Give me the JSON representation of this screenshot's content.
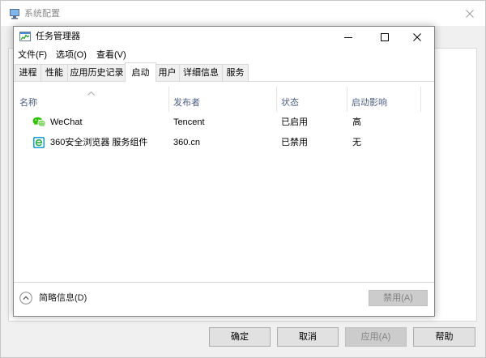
{
  "background_window": {
    "title": "系统配置",
    "title_icon": "system-configuration-icon",
    "close_icon": "close-icon",
    "buttons": [
      {
        "label": "确定",
        "disabled": false
      },
      {
        "label": "取消",
        "disabled": false
      },
      {
        "label": "应用(A)",
        "disabled": true
      },
      {
        "label": "帮助",
        "disabled": false
      }
    ]
  },
  "task_manager": {
    "title": "任务管理器",
    "title_icon": "task-manager-icon",
    "window_controls": [
      "minimize-icon",
      "maximize-icon",
      "close-icon"
    ],
    "menu": [
      {
        "label": "文件(F)"
      },
      {
        "label": "选项(O)"
      },
      {
        "label": "查看(V)"
      }
    ],
    "tabs": [
      {
        "label": "进程",
        "selected": false
      },
      {
        "label": "性能",
        "selected": false
      },
      {
        "label": "应用历史记录",
        "selected": false
      },
      {
        "label": "启动",
        "selected": true
      },
      {
        "label": "用户",
        "selected": false
      },
      {
        "label": "详细信息",
        "selected": false
      },
      {
        "label": "服务",
        "selected": false
      }
    ],
    "columns": [
      {
        "label": "名称"
      },
      {
        "label": "发布者"
      },
      {
        "label": "状态"
      },
      {
        "label": "启动影响"
      }
    ],
    "sort": {
      "column_index": 0,
      "ascending": true,
      "icon": "sort-ascending-icon"
    },
    "rows": [
      {
        "icon": "wechat-icon",
        "name": "WeChat",
        "publisher": "Tencent",
        "status": "已启用",
        "impact": "高"
      },
      {
        "icon": "360-browser-icon",
        "name": "360安全浏览器 服务组件",
        "publisher": "360.cn",
        "status": "已禁用",
        "impact": "无"
      }
    ],
    "footer": {
      "toggle_icon": "chevron-up-circle-icon",
      "fewer_details_label": "简略信息(D)",
      "disable_button": {
        "label": "禁用(A)",
        "disabled": true
      }
    }
  },
  "colors": {
    "window_background": "#f0f0f0",
    "header_text": "#4d6082",
    "disabled_text": "#838383",
    "wechat_green": "#2dc100",
    "browser_blue": "#1a9bd7"
  }
}
